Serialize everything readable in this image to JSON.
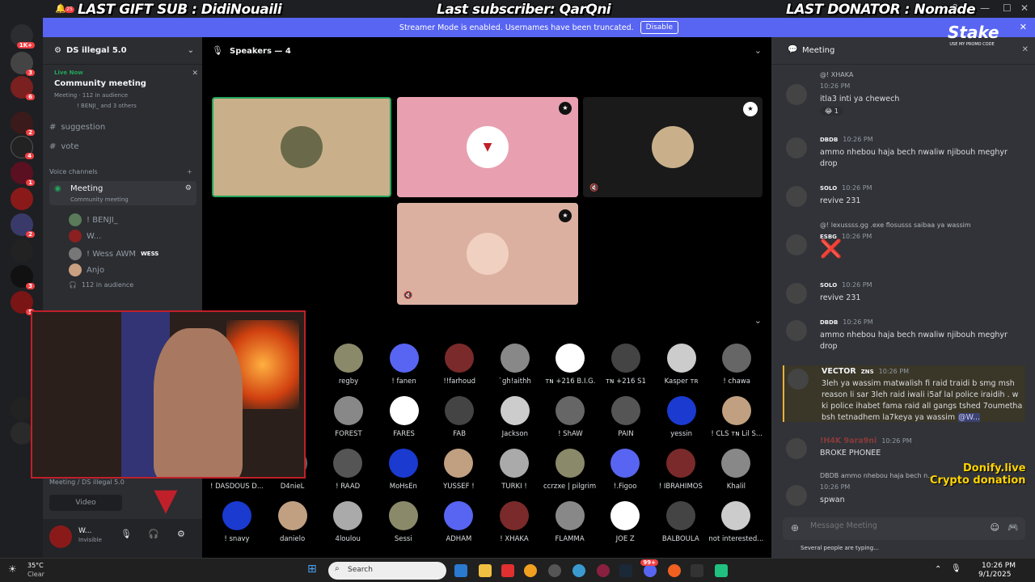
{
  "overlay": {
    "gift": "LAST GIFT SUB : DidiNouaili",
    "subscriber": "Last subscriber: QarQni",
    "donator": "LAST DONATOR : Nomade"
  },
  "banner": {
    "text": "Streamer Mode is enabled. Usernames have been truncated.",
    "button": "Disable"
  },
  "stake": {
    "logo": "Stake",
    "tagline": "USE MY PROMO CODE"
  },
  "rail_badges": [
    "1K+",
    "3",
    "6",
    "2",
    "4",
    "1",
    "2",
    "5",
    "2",
    "3",
    "5"
  ],
  "server": {
    "name": "DS illegal 5.0"
  },
  "live": {
    "status": "Live Now",
    "title": "Community meeting",
    "meta": "Meeting · 112 in audience",
    "participants": "! BENJI_ and 3 others"
  },
  "channels": {
    "suggestion": "suggestion",
    "vote": "vote",
    "voice_header": "Voice channels",
    "meeting": "Meeting",
    "meeting_sub": "Community meeting",
    "audience": "112 in audience",
    "members": [
      "! BENJI_",
      "W...",
      "! Wess AWM",
      "Anjo"
    ],
    "wess_tag": "WESS"
  },
  "user": {
    "name": "W...",
    "status": "Invisible",
    "voice_path": "Meeting / DS illegal 5.0",
    "video": "Video"
  },
  "stage": {
    "speakers_label": "Speakers — 4"
  },
  "audience_rows": [
    [
      "regby",
      "! fanen",
      "!!farhoud",
      "`gh!aithh",
      "ᴛɴ +216 B.I.G.",
      "ᴛɴ +216 S1",
      "Kasper ᴛʀ",
      "! chawa"
    ],
    [
      "FOREST",
      "FARES",
      "FAB",
      "Jackson",
      "! ShAW",
      "PAIN",
      "yessin",
      "! CLS ᴛɴ Lil S..."
    ],
    [
      "! DASDOUS D...",
      "D4nieL",
      "! RAAD",
      "MoHsEn",
      "YUSSEF !",
      "TURKI !",
      "ccrzxe | pilgrim",
      "!.Figoo",
      "! IBRAHIMOS",
      "Khalil"
    ],
    [
      "! snavy",
      "danielo",
      "4loulou",
      "Sessi",
      "ADHAM",
      "! XHAKA",
      "FLAMMA",
      "JOE Z",
      "BALBOULA",
      "not interested..."
    ]
  ],
  "chat": {
    "title": "Meeting",
    "messages": [
      {
        "reply": "@! XHAKA",
        "time": "10:26 PM",
        "body": "itla3 inti ya chewech",
        "reaction": "1"
      },
      {
        "tag": "DBDB",
        "time": "10:26 PM",
        "body": "ammo nhebou haja bech nwaliw njibouh meghyr drop"
      },
      {
        "tag": "SOLO",
        "time": "10:26 PM",
        "body": "revive 231"
      },
      {
        "reply": "@! lexussss.gg  .exe  flosusss saibaa ya wassim",
        "tag": "ESBG",
        "time": "10:26 PM",
        "body": "❌"
      },
      {
        "tag": "SOLO",
        "time": "10:26 PM",
        "body": "revive 231"
      },
      {
        "tag": "DBDB",
        "time": "10:26 PM",
        "body": "ammo nhebou haja bech nwaliw njibouh meghyr drop"
      },
      {
        "name": "VECTOR",
        "tag": "ZNS",
        "time": "10:26 PM",
        "body": "3leh ya wassim matwalish fi raid traidi b smg msh reason li sar 3leh raid iwali i5af lal police iraidih . w ki police ihabet fama raid all gangs tshed 7oumetha bsh tetnadhem la7keya ya wassim",
        "mention": "@W..."
      },
      {
        "name": "!H4K 9ara9ni",
        "time": "10:26 PM",
        "body": "BROKE PHONEE"
      },
      {
        "reply": "DBDB  ammo nhebou haja bech n...",
        "time": "10:26 PM",
        "body": "spwan"
      }
    ],
    "input_placeholder": "Message Meeting",
    "typing": "Several people are typing..."
  },
  "donify": {
    "line1": "Donify.live",
    "line2": "Crypto donation"
  },
  "taskbar": {
    "temp": "35°C",
    "weather": "Clear",
    "search": "Search",
    "time": "10:26 PM",
    "date": "9/1/2025",
    "notif": "99+"
  },
  "colors": {
    "blurple": "#5865f2",
    "bg": "#313338",
    "sidebar": "#2b2d31",
    "live": "#23a55a"
  }
}
